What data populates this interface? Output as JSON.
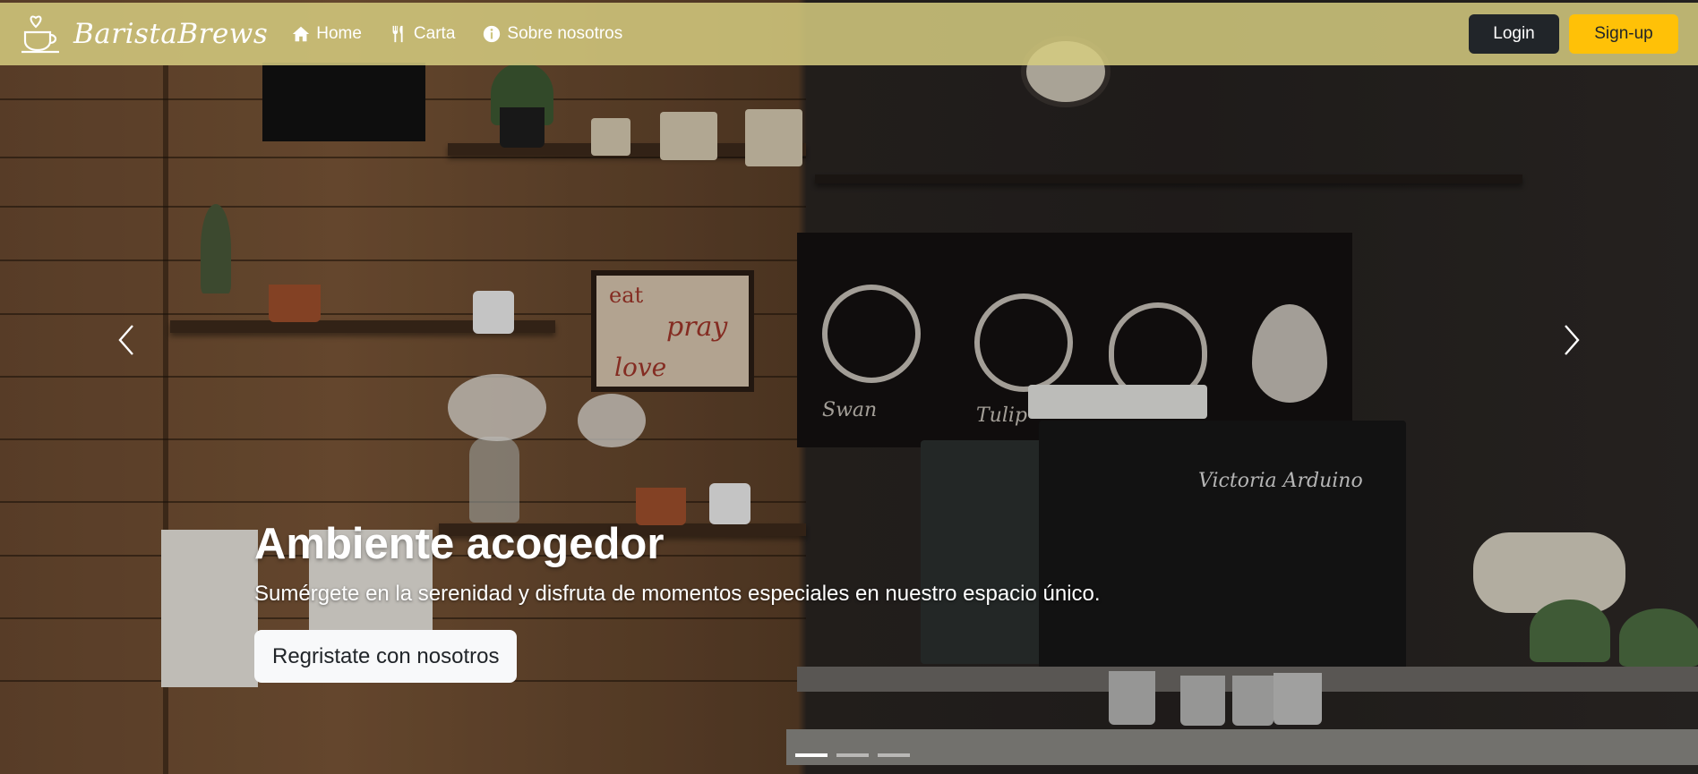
{
  "navbar": {
    "brand": "BaristaBrews",
    "links": [
      {
        "label": "Home",
        "icon": "home-icon"
      },
      {
        "label": "Carta",
        "icon": "utensils-icon"
      },
      {
        "label": "Sobre nosotros",
        "icon": "info-icon"
      }
    ],
    "login_label": "Login",
    "signup_label": "Sign-up",
    "colors": {
      "navbar_bg": "#d6cd80",
      "login_bg": "#212529",
      "signup_bg": "#ffc107"
    }
  },
  "hero": {
    "title": "Ambiente acogedor",
    "subtitle": "Sumérgete en la serenidad y disfruta de momentos especiales en nuestro espacio único.",
    "cta_label": "Regristate con nosotros",
    "scene_text": {
      "frame_line1": "eat",
      "frame_line2": "pray",
      "frame_line3": "love",
      "latte1": "Swan",
      "latte2": "Tulip",
      "machine": "Victoria Arduino"
    },
    "indicators": {
      "count": 3,
      "active_index": 0
    }
  }
}
